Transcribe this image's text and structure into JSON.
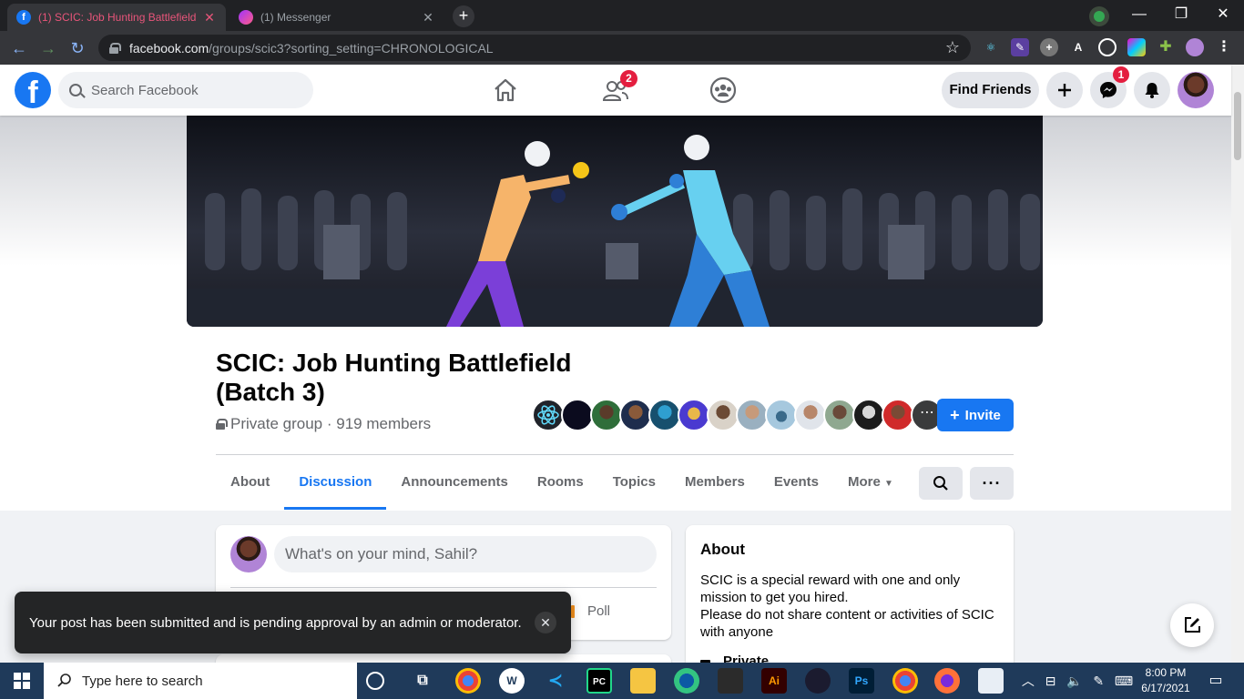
{
  "browser": {
    "tabs": [
      {
        "title": "(1) SCIC: Job Hunting Battlefield",
        "active": true
      },
      {
        "title": "(1) Messenger",
        "active": false
      }
    ],
    "url_domain": "facebook.com",
    "url_path": "/groups/scic3?sorting_setting=CHRONOLOGICAL",
    "new_tab": "+",
    "window_controls": [
      "—",
      "❐",
      "✕"
    ]
  },
  "fb_header": {
    "logo": "f",
    "search_placeholder": "Search Facebook",
    "friends_badge": "2",
    "find_friends_label": "Find Friends",
    "messenger_badge": "1"
  },
  "group": {
    "title": "SCIC: Job Hunting Battlefield (Batch 3)",
    "privacy": "Private group",
    "members_text": "· 919 members",
    "invite_label": "Invite"
  },
  "group_tabs": [
    "About",
    "Discussion",
    "Announcements",
    "Rooms",
    "Topics",
    "Members",
    "Events",
    "More"
  ],
  "composer": {
    "placeholder": "What's on your mind, Sahil?",
    "poll_label": "Poll"
  },
  "about_card": {
    "title": "About",
    "description_1": "SCIC is a special reward with one and only mission to get you hired.",
    "description_2": "Please do not share content or activities of SCIC with anyone",
    "privacy": "Private"
  },
  "toast": {
    "message": "Your post has been submitted and is pending approval by an admin or moderator."
  },
  "taskbar": {
    "search_placeholder": "Type here to search",
    "time": "8:00 PM",
    "date": "6/17/2021"
  },
  "colors": {
    "fb_blue": "#1877f2",
    "badge_red": "#e41e3f",
    "toast_bg": "#242526",
    "tab_title_pink": "#e8557a"
  }
}
